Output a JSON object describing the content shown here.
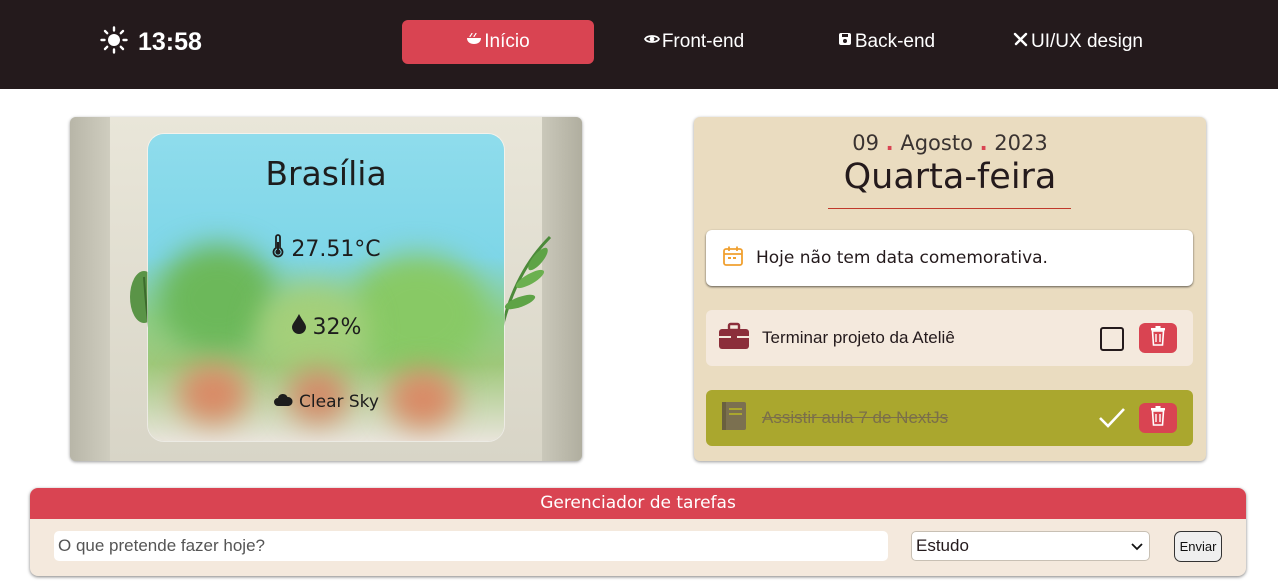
{
  "header": {
    "time": "13:58",
    "nav": [
      {
        "label": "Início",
        "icon": "bowl-icon",
        "active": true
      },
      {
        "label": "Front-end",
        "icon": "eye-icon",
        "active": false
      },
      {
        "label": "Back-end",
        "icon": "save-icon",
        "active": false
      },
      {
        "label": "UI/UX design",
        "icon": "tools-icon",
        "active": false
      }
    ]
  },
  "weather": {
    "city": "Brasília",
    "temperature": "27.51°C",
    "humidity": "32%",
    "condition": "Clear Sky"
  },
  "calendar": {
    "day": "09",
    "month": "Agosto",
    "year": "2023",
    "weekday": "Quarta-feira",
    "holiday_text": "Hoje não tem data comemorativa."
  },
  "tasks": [
    {
      "label": "Terminar projeto da Ateliê",
      "category": "Trabalho",
      "icon": "briefcase-icon",
      "done": false
    },
    {
      "label": "Assistir aula 7 de NextJs",
      "category": "Estudo",
      "icon": "book-icon",
      "done": true
    }
  ],
  "manager": {
    "title": "Gerenciador de tarefas",
    "input_placeholder": "O que pretende fazer hoje?",
    "category_selected": "Estudo",
    "submit_label": "Enviar"
  },
  "colors": {
    "header_bg": "#241a1c",
    "accent": "#d94452",
    "calendar_bg": "#eadcc0",
    "task_done_bg": "#aaa72e",
    "task_bg": "#f4e9dd"
  }
}
